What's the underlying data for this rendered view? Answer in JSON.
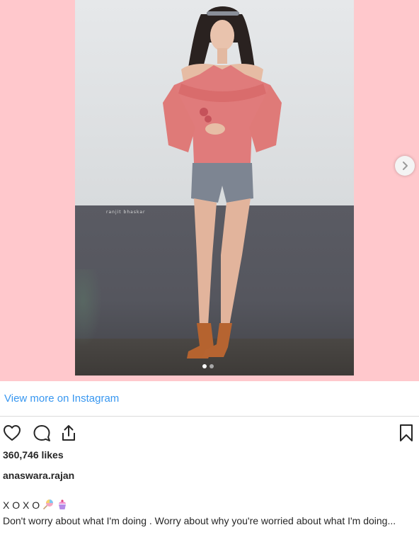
{
  "post": {
    "photo_watermark": "ranjit bhaskar",
    "carousel": {
      "count": 2,
      "active_index": 0
    },
    "view_more_text": "View more on Instagram",
    "likes_text": "360,746 likes",
    "username": "anaswara.rajan",
    "caption_line1": "X O X O",
    "caption_emojis": [
      "lollipop-icon",
      "cupcake-icon"
    ],
    "caption_body": "Don't worry about what I'm doing . Worry about why you're worried about what I'm doing..."
  },
  "icons": {
    "like": "heart-icon",
    "comment": "comment-icon",
    "share": "share-icon",
    "save": "bookmark-icon",
    "next": "chevron-right-icon"
  },
  "colors": {
    "background_pink": "#ffc8cc",
    "link_blue": "#3897f0",
    "text": "#262626"
  }
}
